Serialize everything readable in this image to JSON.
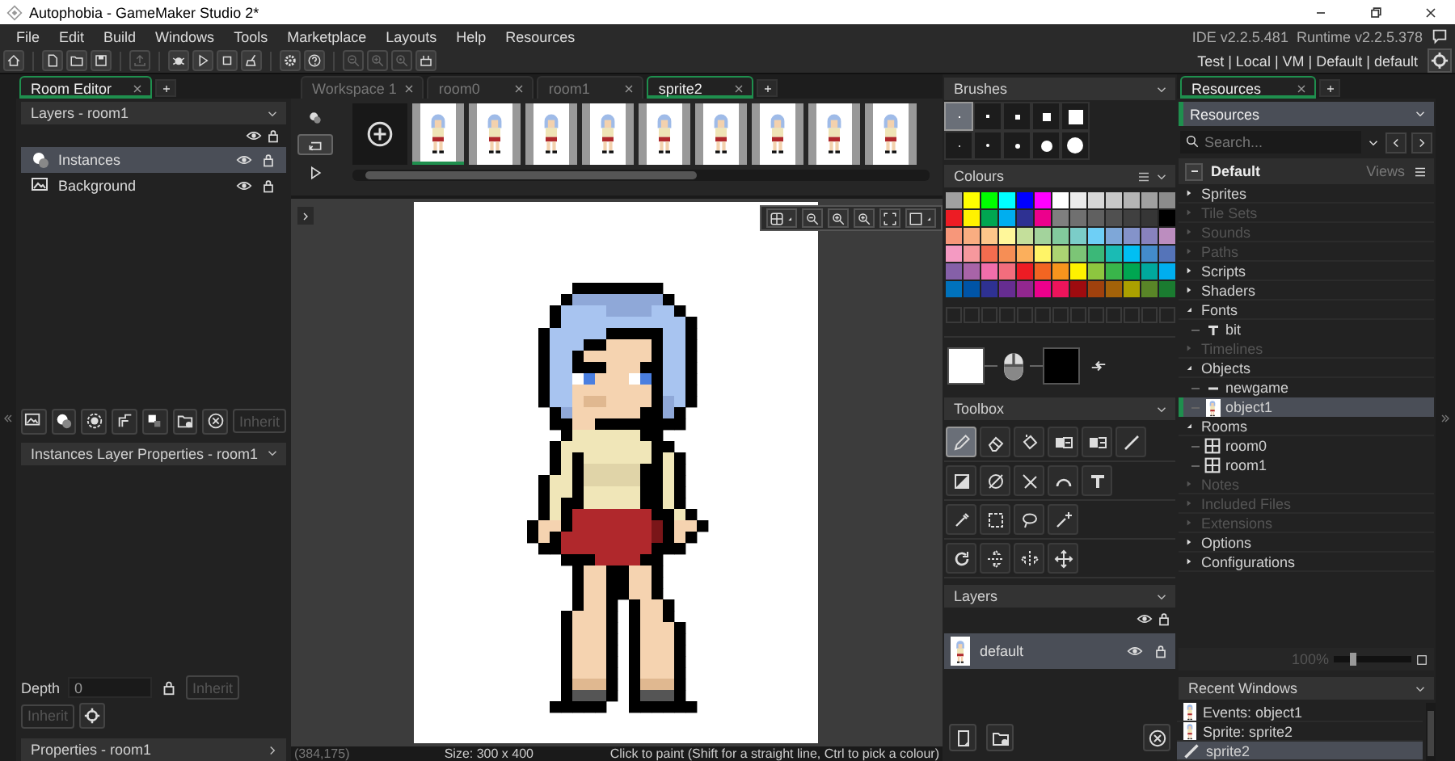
{
  "window": {
    "title": "Autophobia - GameMaker Studio 2*"
  },
  "menu": [
    "File",
    "Edit",
    "Build",
    "Windows",
    "Tools",
    "Marketplace",
    "Layouts",
    "Help",
    "Resources"
  ],
  "versions": {
    "ide": "IDE v2.2.5.481",
    "runtime": "Runtime v2.2.5.378"
  },
  "toolbar": [
    [
      {
        "kind": "home",
        "disabled": false
      }
    ],
    [
      {
        "kind": "new-file",
        "disabled": false
      },
      {
        "kind": "open-folder",
        "disabled": false
      },
      {
        "kind": "save",
        "disabled": false
      }
    ],
    [
      {
        "kind": "export",
        "disabled": true
      }
    ],
    [
      {
        "kind": "bug",
        "disabled": false
      },
      {
        "kind": "play",
        "disabled": false
      },
      {
        "kind": "stop",
        "disabled": false
      },
      {
        "kind": "broom",
        "disabled": false
      }
    ],
    [
      {
        "kind": "gear",
        "disabled": false
      },
      {
        "kind": "help",
        "disabled": false
      }
    ],
    [
      {
        "kind": "zoom-out",
        "disabled": true
      },
      {
        "kind": "zoom-in",
        "disabled": true
      },
      {
        "kind": "zoom-reset",
        "disabled": true
      },
      {
        "kind": "gamepad",
        "disabled": false
      }
    ]
  ],
  "target": "Test | Local | VM | Default | default",
  "left_panel": {
    "tab": "Room Editor",
    "layers_header": "Layers - room1",
    "layers": [
      {
        "name": "Instances",
        "kind": "instances",
        "selected": true
      },
      {
        "name": "Background",
        "kind": "background",
        "selected": false
      }
    ],
    "layer_inherit": {
      "label": "Inherit",
      "disabled": true
    },
    "properties_header": "Instances Layer Properties - room1",
    "depth": {
      "label": "Depth",
      "value": "0"
    },
    "depth_inherit": {
      "label": "Inherit",
      "disabled": true
    },
    "inherit": {
      "label": "Inherit",
      "disabled": true
    },
    "footer": "Properties - room1"
  },
  "document_tabs": [
    {
      "label": "Workspace 1",
      "selected": false
    },
    {
      "label": "room0",
      "selected": false
    },
    {
      "label": "room1",
      "selected": false
    },
    {
      "label": "sprite2",
      "selected": true
    }
  ],
  "sprite_editor": {
    "playback_tools": [
      {
        "kind": "onion",
        "selected": false
      },
      {
        "kind": "loop",
        "selected": true
      },
      {
        "kind": "play",
        "selected": false
      }
    ],
    "frames": [
      {
        "selected": true
      },
      {
        "selected": false
      },
      {
        "selected": false
      },
      {
        "selected": false
      },
      {
        "selected": false
      },
      {
        "selected": false
      },
      {
        "selected": false
      },
      {
        "selected": false
      },
      {
        "selected": false
      }
    ],
    "status": {
      "position": "(384,175)",
      "size": "Size: 300 x 400",
      "hint": "Click to paint (Shift for a straight line, Ctrl to pick a colour)"
    }
  },
  "brushes": {
    "title": "Brushes",
    "items": [
      {
        "kind": "square",
        "selected": true
      },
      {
        "kind": "square",
        "selected": false
      },
      {
        "kind": "square",
        "selected": false
      },
      {
        "kind": "square",
        "selected": false
      },
      {
        "kind": "square",
        "selected": false
      },
      {
        "kind": "circle",
        "selected": false
      },
      {
        "kind": "circle",
        "selected": false
      },
      {
        "kind": "circle",
        "selected": false
      },
      {
        "kind": "circle",
        "selected": false
      },
      {
        "kind": "circle",
        "selected": false
      }
    ]
  },
  "colours": {
    "title": "Colours",
    "swatches": [
      [
        {
          "color": "#a0a0a0"
        },
        {
          "color": "#ffff00"
        },
        {
          "color": "#00ff00"
        },
        {
          "color": "#00ffff"
        },
        {
          "color": "#0000ff"
        },
        {
          "color": "#ff00ff"
        },
        {
          "color": "#ffffff"
        },
        {
          "color": "#ebebeb"
        },
        {
          "color": "#d7d7d7"
        },
        {
          "color": "#c8c8c8"
        },
        {
          "color": "#b4b4b4"
        },
        {
          "color": "#a0a0a0"
        },
        {
          "color": "#8c8c8c"
        }
      ],
      [
        {
          "color": "#ed1c24"
        },
        {
          "color": "#fff200"
        },
        {
          "color": "#00a651"
        },
        {
          "color": "#00aeef"
        },
        {
          "color": "#2e3192"
        },
        {
          "color": "#ec008c"
        },
        {
          "color": "#7f7f7f"
        },
        {
          "color": "#707070"
        },
        {
          "color": "#606060"
        },
        {
          "color": "#505050"
        },
        {
          "color": "#404040"
        },
        {
          "color": "#363636"
        },
        {
          "color": "#000000"
        }
      ],
      [
        {
          "color": "#f7977a"
        },
        {
          "color": "#f9ad81"
        },
        {
          "color": "#fdc68a"
        },
        {
          "color": "#fff79a"
        },
        {
          "color": "#c4df9b"
        },
        {
          "color": "#a3d39c"
        },
        {
          "color": "#82ca9d"
        },
        {
          "color": "#7bcdc8"
        },
        {
          "color": "#6ecff6"
        },
        {
          "color": "#7ea7d8"
        },
        {
          "color": "#8493ca"
        },
        {
          "color": "#8882be"
        },
        {
          "color": "#bc8dbf"
        }
      ],
      [
        {
          "color": "#f49ac2"
        },
        {
          "color": "#f6989d"
        },
        {
          "color": "#f26c4f"
        },
        {
          "color": "#f68e55"
        },
        {
          "color": "#fbaf5c"
        },
        {
          "color": "#fff467"
        },
        {
          "color": "#acd372"
        },
        {
          "color": "#7cc576"
        },
        {
          "color": "#3bb878"
        },
        {
          "color": "#1abbb4"
        },
        {
          "color": "#00bff3"
        },
        {
          "color": "#438ccb"
        },
        {
          "color": "#5574b9"
        }
      ],
      [
        {
          "color": "#8560a8"
        },
        {
          "color": "#a864a8"
        },
        {
          "color": "#f06eaa"
        },
        {
          "color": "#f26d7d"
        },
        {
          "color": "#ed1c24"
        },
        {
          "color": "#f26522"
        },
        {
          "color": "#f7941d"
        },
        {
          "color": "#fff200"
        },
        {
          "color": "#8dc63f"
        },
        {
          "color": "#39b54a"
        },
        {
          "color": "#00a651"
        },
        {
          "color": "#00a99d"
        },
        {
          "color": "#00aeef"
        }
      ],
      [
        {
          "color": "#0072bc"
        },
        {
          "color": "#0054a6"
        },
        {
          "color": "#2e3192"
        },
        {
          "color": "#662d91"
        },
        {
          "color": "#92278f"
        },
        {
          "color": "#ec008c"
        },
        {
          "color": "#ed145b"
        },
        {
          "color": "#9e0b0f"
        },
        {
          "color": "#a0410d"
        },
        {
          "color": "#a36209"
        },
        {
          "color": "#aba000"
        },
        {
          "color": "#598527"
        },
        {
          "color": "#1a7b30"
        }
      ]
    ],
    "primary": {
      "color": "#ffffff"
    },
    "secondary": {
      "color": "#000000"
    }
  },
  "toolbox": {
    "title": "Toolbox",
    "rows": [
      [
        {
          "kind": "pencil",
          "selected": true
        },
        {
          "kind": "eraser",
          "selected": false
        },
        {
          "kind": "fill",
          "selected": false
        },
        {
          "kind": "replace",
          "selected": false
        },
        {
          "kind": "replace-all",
          "selected": false
        },
        {
          "kind": "line",
          "selected": false
        }
      ],
      [
        {
          "kind": "rect",
          "selected": false
        },
        {
          "kind": "ellipse",
          "selected": false
        },
        {
          "kind": "polygon",
          "selected": false
        },
        {
          "kind": "arc",
          "selected": false
        },
        {
          "kind": "text",
          "selected": false
        }
      ],
      [
        {
          "kind": "eyedropper",
          "selected": false
        },
        {
          "kind": "select",
          "selected": false
        },
        {
          "kind": "lasso",
          "selected": false
        },
        {
          "kind": "wand",
          "selected": false
        }
      ],
      [
        {
          "kind": "rotate",
          "selected": false
        },
        {
          "kind": "flip-v",
          "selected": false
        },
        {
          "kind": "flip-h",
          "selected": false
        },
        {
          "kind": "move",
          "selected": false
        }
      ]
    ]
  },
  "sprite_layers": {
    "title": "Layers",
    "items": [
      {
        "name": "default",
        "selected": true
      }
    ]
  },
  "resources": {
    "tab": "Resources",
    "header": "Resources",
    "search": {
      "placeholder": "Search..."
    },
    "group": "Default",
    "views": "Views",
    "tree": [
      {
        "label": "Sprites",
        "expanded": false,
        "disabled": false
      },
      {
        "label": "Tile Sets",
        "expanded": false,
        "disabled": true
      },
      {
        "label": "Sounds",
        "expanded": false,
        "disabled": true
      },
      {
        "label": "Paths",
        "expanded": false,
        "disabled": true
      },
      {
        "label": "Scripts",
        "expanded": false,
        "disabled": false
      },
      {
        "label": "Shaders",
        "expanded": false,
        "disabled": false
      },
      {
        "label": "Fonts",
        "expanded": true,
        "disabled": false,
        "children": [
          {
            "label": "bit",
            "kind": "font",
            "selected": false
          }
        ]
      },
      {
        "label": "Timelines",
        "expanded": false,
        "disabled": true
      },
      {
        "label": "Objects",
        "expanded": true,
        "disabled": false,
        "children": [
          {
            "label": "newgame",
            "kind": "bar",
            "selected": false
          },
          {
            "label": "object1",
            "kind": "sprite",
            "selected": true
          }
        ]
      },
      {
        "label": "Rooms",
        "expanded": true,
        "disabled": false,
        "children": [
          {
            "label": "room0",
            "kind": "room",
            "selected": false
          },
          {
            "label": "room1",
            "kind": "room",
            "selected": false
          }
        ]
      },
      {
        "label": "Notes",
        "expanded": false,
        "disabled": true
      },
      {
        "label": "Included Files",
        "expanded": false,
        "disabled": true
      },
      {
        "label": "Extensions",
        "expanded": false,
        "disabled": true
      },
      {
        "label": "Options",
        "expanded": false,
        "disabled": false
      },
      {
        "label": "Configurations",
        "expanded": false,
        "disabled": false
      }
    ],
    "zoom": {
      "label": "100%",
      "level": 0.25
    }
  },
  "recent_windows": {
    "title": "Recent Windows",
    "items": [
      {
        "label": "Events: object1",
        "kind": "sprite",
        "selected": false
      },
      {
        "label": "Sprite: sprite2",
        "kind": "sprite",
        "selected": false
      },
      {
        "label": "sprite2",
        "kind": "brush",
        "selected": true
      }
    ]
  }
}
